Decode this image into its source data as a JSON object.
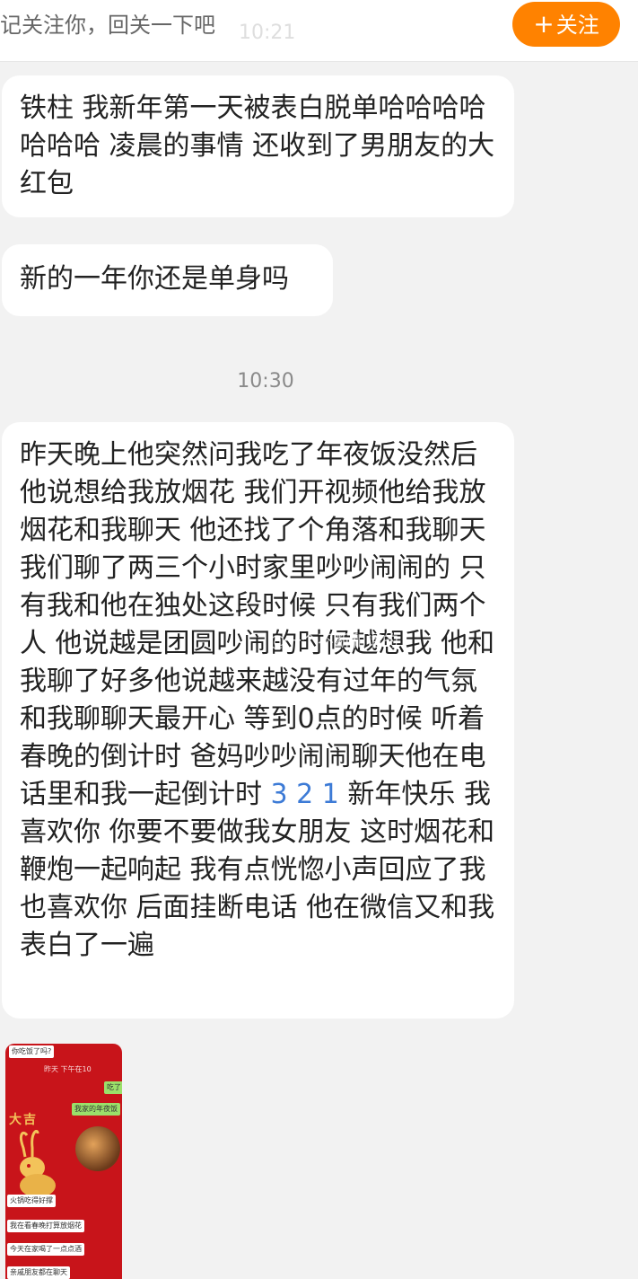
{
  "header": {
    "hint_text": "记关注你，回关一下吧",
    "ghost_time": "10:21",
    "follow_button": {
      "icon": "plus-icon",
      "label": "关注"
    }
  },
  "messages": [
    {
      "text": "铁柱 我新年第一天被表白脱单哈哈哈哈哈哈哈 凌晨的事情 还收到了男朋友的大红包"
    },
    {
      "text": "新的一年你还是单身吗"
    },
    {
      "text_before": "昨天晚上他突然问我吃了年夜饭没然后他说想给我放烟花 我们开视频他给我放烟花和我聊天 他还找了个角落和我聊天 我们聊了两三个小时家里吵吵闹闹的 只有我和他在独处这段时候 只有我们两个人 他说越是团圆吵闹的时候越想我  他和我聊了好多他说越来越没有过年的气氛 和我聊聊天最开心 等到0点的时候 听着春晚的倒计时 爸妈吵吵闹闹聊天他在电话里和我一起倒计时 ",
      "highlight": "3 2 1",
      "text_after": " 新年快乐 我喜欢你 你要不要做我女朋友 这时烟花和鞭炮一起响起 我有点恍惚小声回应了我也喜欢你 后面挂断电话 他在微信又和我表白了一遍"
    }
  ],
  "timestamp": "10:30",
  "watermark": "@一个不断和谐的",
  "thumbnail": {
    "chips": [
      "你吃饭了吗?",
      "吃了",
      "我家的年夜饭",
      "火锅吃得好撑",
      "我在看春晚打算放烟花",
      "今天在家喝了一点点酒",
      "亲戚朋友都在聊天"
    ],
    "tiny": "昨天 下午在10",
    "deco": [
      "大",
      "吉"
    ]
  },
  "colors": {
    "accent": "#ff8200",
    "highlight_number": "#3d7bd6",
    "background": "#f2f2f2"
  }
}
